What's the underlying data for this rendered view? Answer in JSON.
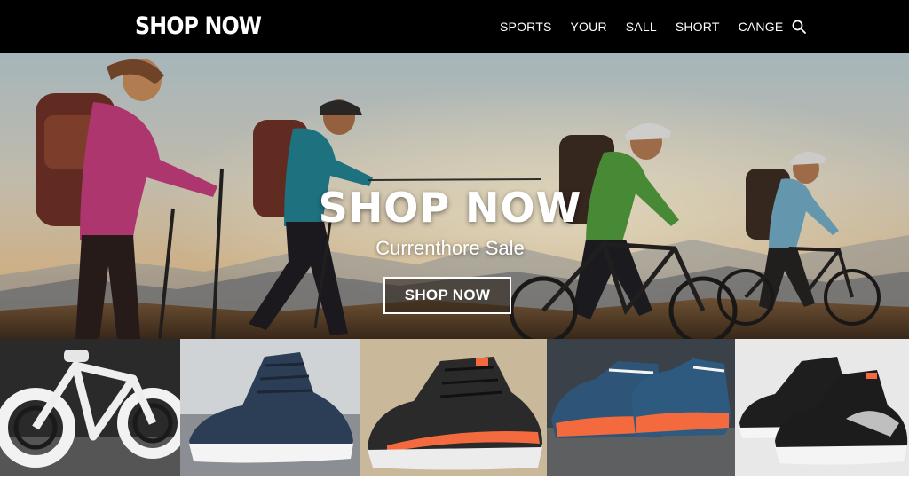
{
  "header": {
    "logo": "SHOP NOW",
    "nav": [
      {
        "label": "SPORTS"
      },
      {
        "label": "YOUR"
      },
      {
        "label": "SALL"
      },
      {
        "label": "SHORT"
      },
      {
        "label": "CANGE"
      }
    ],
    "search_icon": "search-icon"
  },
  "hero": {
    "title": "SHOP NOW",
    "subtitle": "Currenthore Sale",
    "button_label": "SHOP NOW"
  },
  "products": [
    {
      "name": "white-bike-product",
      "icon": "bicycle-photo"
    },
    {
      "name": "navy-sneaker-product",
      "icon": "sneaker-photo"
    },
    {
      "name": "black-orange-running-shoe-product",
      "icon": "sneaker-photo"
    },
    {
      "name": "blue-orange-shoe-pair-product",
      "icon": "sneaker-photo"
    },
    {
      "name": "black-grey-sneaker-product",
      "icon": "sneaker-photo"
    }
  ],
  "colors": {
    "header_bg": "#000000",
    "text": "#ffffff",
    "accent_orange": "#f26a3d"
  }
}
